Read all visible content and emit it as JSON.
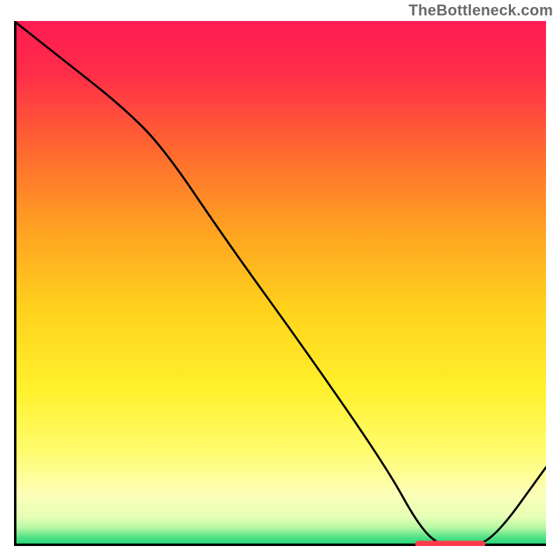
{
  "watermark": "TheBottleneck.com",
  "chart_data": {
    "type": "line",
    "title": "",
    "xlabel": "",
    "ylabel": "",
    "xlim": [
      0,
      100
    ],
    "ylim": [
      0,
      100
    ],
    "grid": false,
    "legend": false,
    "series": [
      {
        "name": "curve",
        "x": [
          0,
          10,
          20,
          28,
          40,
          55,
          70,
          76,
          80,
          85,
          90,
          100
        ],
        "y": [
          100,
          92,
          84,
          76,
          58,
          37,
          15,
          4,
          0,
          0,
          1,
          15
        ]
      }
    ],
    "marker_segment": {
      "x0": 76,
      "x1": 88,
      "y": 0,
      "color": "#ff3a49"
    },
    "gradient_stops": [
      {
        "offset": 0.0,
        "color": "#ff1b52"
      },
      {
        "offset": 0.1,
        "color": "#ff2d49"
      },
      {
        "offset": 0.25,
        "color": "#ff6a2f"
      },
      {
        "offset": 0.4,
        "color": "#ffa321"
      },
      {
        "offset": 0.55,
        "color": "#ffd21c"
      },
      {
        "offset": 0.7,
        "color": "#fff02b"
      },
      {
        "offset": 0.82,
        "color": "#fffc6e"
      },
      {
        "offset": 0.9,
        "color": "#fdffb8"
      },
      {
        "offset": 0.945,
        "color": "#e5ffb5"
      },
      {
        "offset": 0.965,
        "color": "#b6f7a4"
      },
      {
        "offset": 0.985,
        "color": "#4be084"
      },
      {
        "offset": 1.0,
        "color": "#14d977"
      }
    ],
    "axis_color": "#000000",
    "line_color": "#000000",
    "line_width": 3
  }
}
